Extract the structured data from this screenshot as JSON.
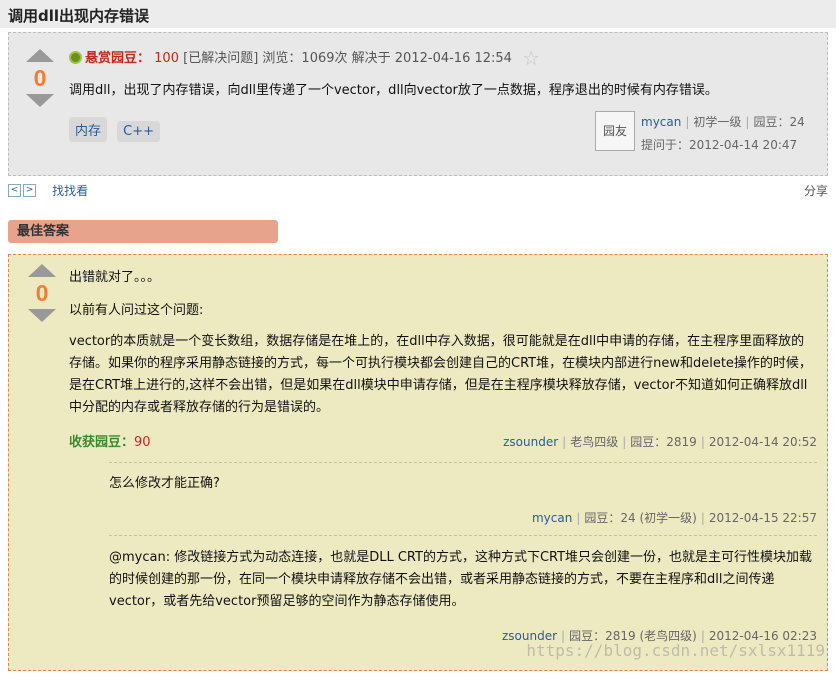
{
  "page": {
    "title": "调用dll出现内存错误"
  },
  "question": {
    "votes": "0",
    "reward_label": "悬赏园豆：",
    "reward_value": "100",
    "status": "[已解决问题]",
    "views": "浏览：1069次",
    "solved_at": "解决于 2012-04-16 12:54",
    "content": "调用dll，出现了内存错误，向dll里传递了一个vector，dll向vector放了一点数据，程序退出的时候有内存错误。",
    "tags": [
      "内存",
      "C++"
    ],
    "asker": {
      "avatar_text": "园友",
      "name": "mycan",
      "level": "初学一级",
      "beans": "园豆：24",
      "asked_at": "提问于：2012-04-14 20:47"
    }
  },
  "nav": {
    "prev": "<",
    "next": ">",
    "link": "找找看",
    "share": "分享"
  },
  "best_answer": {
    "tab_label": "最佳答案",
    "votes": "0",
    "p1": "出错就对了。。。",
    "p2": "以前有人问过这个问题:",
    "p3": "vector的本质就是一个变长数组，数据存储是在堆上的，在dll中存入数据，很可能就是在dll中申请的存储，在主程序里面释放的存储。如果你的程序采用静态链接的方式，每一个可执行模块都会创建自己的CRT堆，在模块内部进行new和delete操作的时候，是在CRT堆上进行的,这样不会出错，但是如果在dll模块中申请存储，但是在主程序模块释放存储，vector不知道如何正确释放dll中分配的内存或者释放存储的行为是错误的。",
    "harvest_label": "收获园豆：",
    "harvest_value": "90",
    "author": "zsounder",
    "author_level": "老鸟四级",
    "author_beans": "园豆：2819",
    "answered_at": "2012-04-14 20:52"
  },
  "comments": [
    {
      "text": "怎么修改才能正确?",
      "author": "mycan",
      "info": "园豆：24 (初学一级)",
      "time": "2012-04-15 22:57"
    },
    {
      "text": "@mycan: 修改链接方式为动态连接，也就是DLL CRT的方式，这种方式下CRT堆只会创建一份，也就是主可行性模块加载的时候创建的那一份，在同一个模块申请释放存储不会出错，或者采用静态链接的方式，不要在主程序和dll之间传递vector，或者先给vector预留足够的空间作为静态存储使用。",
      "author": "zsounder",
      "info": "园豆：2819 (老鸟四级)",
      "time": "2012-04-16 02:23"
    }
  ],
  "watermark": "https://blog.csdn.net/sxlsx1119",
  "colors": {
    "vote": "#f07e35",
    "reward": "#c6281c",
    "link": "#2d5a96",
    "answer_bg": "#edeac2",
    "best_tab": "#e8a38c"
  }
}
